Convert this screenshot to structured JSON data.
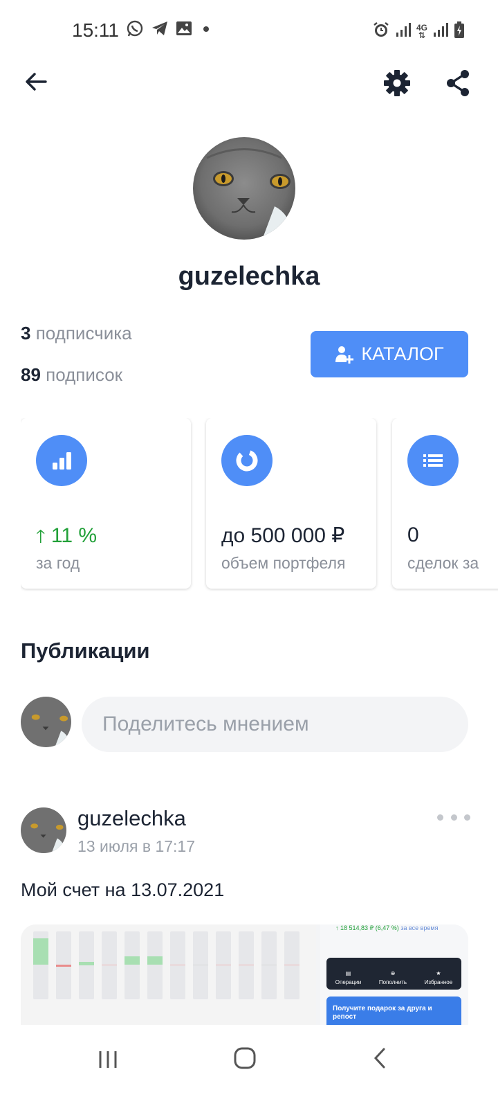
{
  "status_bar": {
    "time": "15:11",
    "left_icons": [
      "whatsapp-icon",
      "telegram-icon",
      "gallery-icon",
      "dot-icon"
    ],
    "right_icons": [
      "alarm-icon",
      "signal-icon",
      "4g-icon",
      "signal-icon",
      "battery-charging-icon"
    ],
    "network": "4G"
  },
  "profile": {
    "username": "guzelechka",
    "followers_count": "3",
    "followers_label": "подписчика",
    "following_count": "89",
    "following_label": "подписок",
    "catalog_button": "КАТАЛОГ"
  },
  "cards": [
    {
      "icon": "bar-chart-icon",
      "value": "11 %",
      "label": "за год",
      "trend": "up",
      "color": "#21a038"
    },
    {
      "icon": "donut-chart-icon",
      "value": "до 500 000 ₽",
      "label": "объем портфеля"
    },
    {
      "icon": "list-icon",
      "value": "0",
      "label": "сделок за"
    }
  ],
  "publications": {
    "title": "Публикации",
    "composer_placeholder": "Поделитесь мнением"
  },
  "post": {
    "author": "guzelechka",
    "time": "13 июля в 17:17",
    "text": "Мой счет на 13.07.2021",
    "attachment": {
      "top_text": "18 514,83 ₽ (6,47 %)",
      "top_suffix": "за все время",
      "actions": [
        "Операции",
        "Пополнить",
        "Избранное"
      ],
      "promo": "Получите подарок за друга и репост"
    }
  },
  "colors": {
    "accent": "#4f8ef7",
    "positive": "#21a038",
    "text_primary": "#1c2433",
    "text_secondary": "#8a8f99"
  }
}
